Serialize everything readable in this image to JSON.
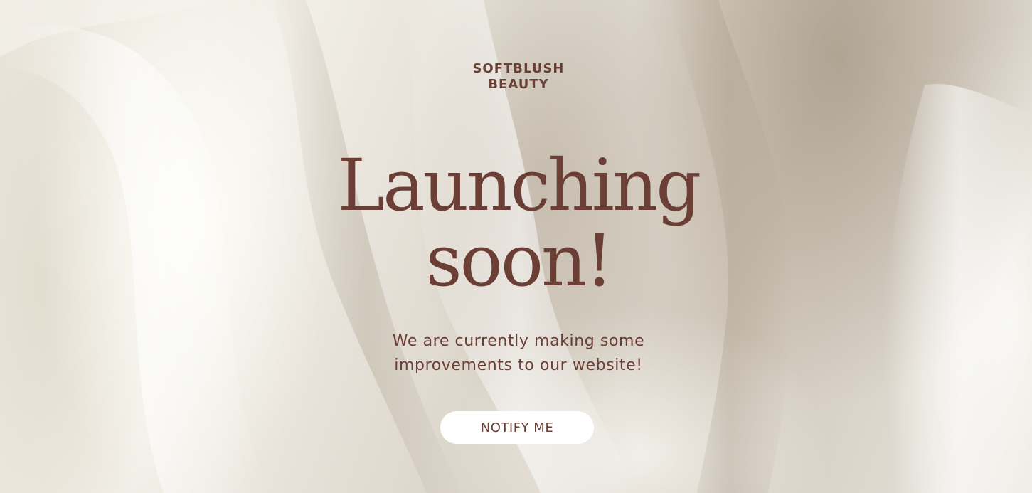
{
  "brand": {
    "line1": "SOFTBLUSH",
    "line2": "BEAUTY"
  },
  "headline": {
    "line1": "Launching",
    "line2": "soon!"
  },
  "subtitle": {
    "line1": "We are currently making some",
    "line2": "improvements to our website!"
  },
  "cta": {
    "label": "NOTIFY ME"
  },
  "colors": {
    "text": "#6b3f36",
    "button_bg": "#ffffff",
    "background": "#ece8df"
  }
}
